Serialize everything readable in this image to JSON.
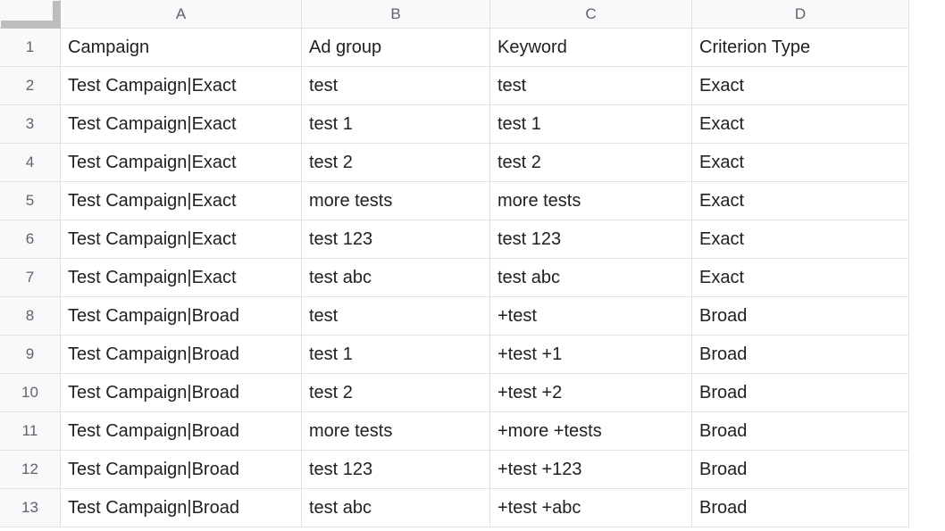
{
  "columns": [
    "A",
    "B",
    "C",
    "D"
  ],
  "row_numbers": [
    "1",
    "2",
    "3",
    "4",
    "5",
    "6",
    "7",
    "8",
    "9",
    "10",
    "11",
    "12",
    "13"
  ],
  "chart_data": {
    "type": "table",
    "headers": [
      "Campaign",
      "Ad group",
      "Keyword",
      "Criterion Type"
    ],
    "rows": [
      [
        "Test Campaign|Exact",
        "test",
        "test",
        "Exact"
      ],
      [
        "Test Campaign|Exact",
        "test 1",
        "test 1",
        "Exact"
      ],
      [
        "Test Campaign|Exact",
        "test 2",
        "test 2",
        "Exact"
      ],
      [
        "Test Campaign|Exact",
        "more tests",
        "more tests",
        "Exact"
      ],
      [
        "Test Campaign|Exact",
        "test 123",
        "test 123",
        "Exact"
      ],
      [
        "Test Campaign|Exact",
        "test abc",
        "test abc",
        "Exact"
      ],
      [
        "Test Campaign|Broad",
        "test",
        "+test",
        "Broad"
      ],
      [
        "Test Campaign|Broad",
        "test 1",
        "+test +1",
        "Broad"
      ],
      [
        "Test Campaign|Broad",
        "test 2",
        "+test +2",
        "Broad"
      ],
      [
        "Test Campaign|Broad",
        "more tests",
        "+more +tests",
        "Broad"
      ],
      [
        "Test Campaign|Broad",
        "test 123",
        "+test +123",
        "Broad"
      ],
      [
        "Test Campaign|Broad",
        "test abc",
        "+test +abc",
        "Broad"
      ]
    ]
  }
}
